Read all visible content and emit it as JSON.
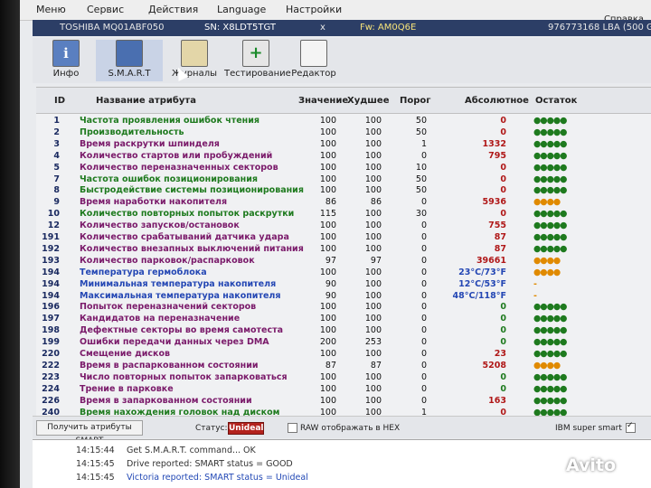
{
  "menu": [
    "Меню",
    "Сервис",
    "Действия",
    "Language",
    "Настройки"
  ],
  "help_label": "Справка",
  "drive": {
    "model": "TOSHIBA MQ01ABF050",
    "sn": "SN: X8LDT5TGT",
    "close": "x",
    "fw": "Fw: AM0Q6E",
    "lba": "976773168 LBA (500 GB)"
  },
  "toolbar": [
    {
      "label": "Инфо",
      "icon": "info-icon"
    },
    {
      "label": "S.M.A.R.T",
      "icon": "smart-icon"
    },
    {
      "label": "Журналы",
      "icon": "logs-icon"
    },
    {
      "label": "Тестирование",
      "icon": "testing-icon"
    },
    {
      "label": "Редактор",
      "icon": "editor-icon"
    }
  ],
  "columns": [
    "ID",
    "Название атрибута",
    "Значение",
    "Худшее",
    "Порог",
    "Абсолютное",
    "Остаток"
  ],
  "colors": {
    "green": "#1e7a1e",
    "purple": "#7a1a6a",
    "blue": "#2447b4",
    "red": "#b01818",
    "orange": "#e08a00"
  },
  "rows": [
    {
      "id": "1",
      "name": "Частота проявления ошибок чтения",
      "value": "100",
      "worst": "100",
      "thresh": "50",
      "abs": "0",
      "rem": "●●●●●",
      "nc": "green",
      "ac": "red",
      "rc": "green"
    },
    {
      "id": "2",
      "name": "Производительность",
      "value": "100",
      "worst": "100",
      "thresh": "50",
      "abs": "0",
      "rem": "●●●●●",
      "nc": "green",
      "ac": "red",
      "rc": "green"
    },
    {
      "id": "3",
      "name": "Время раскрутки шпинделя",
      "value": "100",
      "worst": "100",
      "thresh": "1",
      "abs": "1332",
      "rem": "●●●●●",
      "nc": "purple",
      "ac": "red",
      "rc": "green"
    },
    {
      "id": "4",
      "name": "Количество стартов или пробуждений",
      "value": "100",
      "worst": "100",
      "thresh": "0",
      "abs": "795",
      "rem": "●●●●●",
      "nc": "purple",
      "ac": "red",
      "rc": "green"
    },
    {
      "id": "5",
      "name": "Количество переназначенных секторов",
      "value": "100",
      "worst": "100",
      "thresh": "10",
      "abs": "0",
      "rem": "●●●●●",
      "nc": "purple",
      "ac": "red",
      "rc": "green"
    },
    {
      "id": "7",
      "name": "Частота ошибок позиционирования",
      "value": "100",
      "worst": "100",
      "thresh": "50",
      "abs": "0",
      "rem": "●●●●●",
      "nc": "green",
      "ac": "red",
      "rc": "green"
    },
    {
      "id": "8",
      "name": "Быстродействие системы позиционирования",
      "value": "100",
      "worst": "100",
      "thresh": "50",
      "abs": "0",
      "rem": "●●●●●",
      "nc": "green",
      "ac": "red",
      "rc": "green"
    },
    {
      "id": "9",
      "name": "Время наработки накопителя",
      "value": "86",
      "worst": "86",
      "thresh": "0",
      "abs": "5936",
      "rem": "●●●●",
      "nc": "purple",
      "ac": "red",
      "rc": "orange"
    },
    {
      "id": "10",
      "name": "Количество повторных попыток раскрутки",
      "value": "115",
      "worst": "100",
      "thresh": "30",
      "abs": "0",
      "rem": "●●●●●",
      "nc": "green",
      "ac": "red",
      "rc": "green"
    },
    {
      "id": "12",
      "name": "Количество запусков/остановок",
      "value": "100",
      "worst": "100",
      "thresh": "0",
      "abs": "755",
      "rem": "●●●●●",
      "nc": "purple",
      "ac": "red",
      "rc": "green"
    },
    {
      "id": "191",
      "name": "Количество срабатываний датчика удара",
      "value": "100",
      "worst": "100",
      "thresh": "0",
      "abs": "87",
      "rem": "●●●●●",
      "nc": "purple",
      "ac": "red",
      "rc": "green"
    },
    {
      "id": "192",
      "name": "Количество внезапных выключений питания",
      "value": "100",
      "worst": "100",
      "thresh": "0",
      "abs": "87",
      "rem": "●●●●●",
      "nc": "purple",
      "ac": "red",
      "rc": "green"
    },
    {
      "id": "193",
      "name": "Количество парковок/распарковок",
      "value": "97",
      "worst": "97",
      "thresh": "0",
      "abs": "39661",
      "rem": "●●●●",
      "nc": "purple",
      "ac": "red",
      "rc": "orange"
    },
    {
      "id": "194",
      "name": "Температура гермоблока",
      "value": "100",
      "worst": "100",
      "thresh": "0",
      "abs": "23°C/73°F",
      "rem": "●●●●",
      "nc": "blue",
      "ac": "blue",
      "rc": "orange"
    },
    {
      "id": "194",
      "name": "Минимальная температура накопителя",
      "value": "90",
      "worst": "100",
      "thresh": "0",
      "abs": "12°C/53°F",
      "rem": "-",
      "nc": "blue",
      "ac": "blue",
      "rc": "orange"
    },
    {
      "id": "194",
      "name": "Максимальная температура накопителя",
      "value": "90",
      "worst": "100",
      "thresh": "0",
      "abs": "48°C/118°F",
      "rem": "-",
      "nc": "blue",
      "ac": "blue",
      "rc": "orange"
    },
    {
      "id": "196",
      "name": "Попыток переназначений секторов",
      "value": "100",
      "worst": "100",
      "thresh": "0",
      "abs": "0",
      "rem": "●●●●●",
      "nc": "purple",
      "ac": "green",
      "rc": "green"
    },
    {
      "id": "197",
      "name": "Кандидатов на переназначение",
      "value": "100",
      "worst": "100",
      "thresh": "0",
      "abs": "0",
      "rem": "●●●●●",
      "nc": "purple",
      "ac": "green",
      "rc": "green"
    },
    {
      "id": "198",
      "name": "Дефектные секторы во время самотеста",
      "value": "100",
      "worst": "100",
      "thresh": "0",
      "abs": "0",
      "rem": "●●●●●",
      "nc": "purple",
      "ac": "green",
      "rc": "green"
    },
    {
      "id": "199",
      "name": "Ошибки передачи данных через DMA",
      "value": "200",
      "worst": "253",
      "thresh": "0",
      "abs": "0",
      "rem": "●●●●●",
      "nc": "purple",
      "ac": "green",
      "rc": "green"
    },
    {
      "id": "220",
      "name": "Смещение дисков",
      "value": "100",
      "worst": "100",
      "thresh": "0",
      "abs": "23",
      "rem": "●●●●●",
      "nc": "purple",
      "ac": "red",
      "rc": "green"
    },
    {
      "id": "222",
      "name": "Время в распаркованном состоянии",
      "value": "87",
      "worst": "87",
      "thresh": "0",
      "abs": "5208",
      "rem": "●●●●",
      "nc": "purple",
      "ac": "red",
      "rc": "orange"
    },
    {
      "id": "223",
      "name": "Число повторных попыток запарковаться",
      "value": "100",
      "worst": "100",
      "thresh": "0",
      "abs": "0",
      "rem": "●●●●●",
      "nc": "purple",
      "ac": "green",
      "rc": "green"
    },
    {
      "id": "224",
      "name": "Трение в парковке",
      "value": "100",
      "worst": "100",
      "thresh": "0",
      "abs": "0",
      "rem": "●●●●●",
      "nc": "purple",
      "ac": "green",
      "rc": "green"
    },
    {
      "id": "226",
      "name": "Время в запаркованном состоянии",
      "value": "100",
      "worst": "100",
      "thresh": "0",
      "abs": "163",
      "rem": "●●●●●",
      "nc": "purple",
      "ac": "red",
      "rc": "green"
    },
    {
      "id": "240",
      "name": "Время нахождения головок над диском",
      "value": "100",
      "worst": "100",
      "thresh": "1",
      "abs": "0",
      "rem": "●●●●●",
      "nc": "green",
      "ac": "red",
      "rc": "green"
    }
  ],
  "statusbar": {
    "get_smart": "Получить атрибуты SMART",
    "status_label": "Статус:",
    "status_value": "Unideal",
    "raw_hex": "RAW отображать в HEX",
    "ibm": "IBM super smart"
  },
  "log": [
    {
      "time": "14:15:44",
      "msg": "Get S.M.A.R.T. command... OK",
      "blue": false
    },
    {
      "time": "14:15:45",
      "msg": "Drive reported: SMART status = GOOD",
      "blue": false
    },
    {
      "time": "14:15:45",
      "msg": "Victoria reported: SMART status = Unideal",
      "blue": true
    }
  ],
  "watermark": "Avito"
}
